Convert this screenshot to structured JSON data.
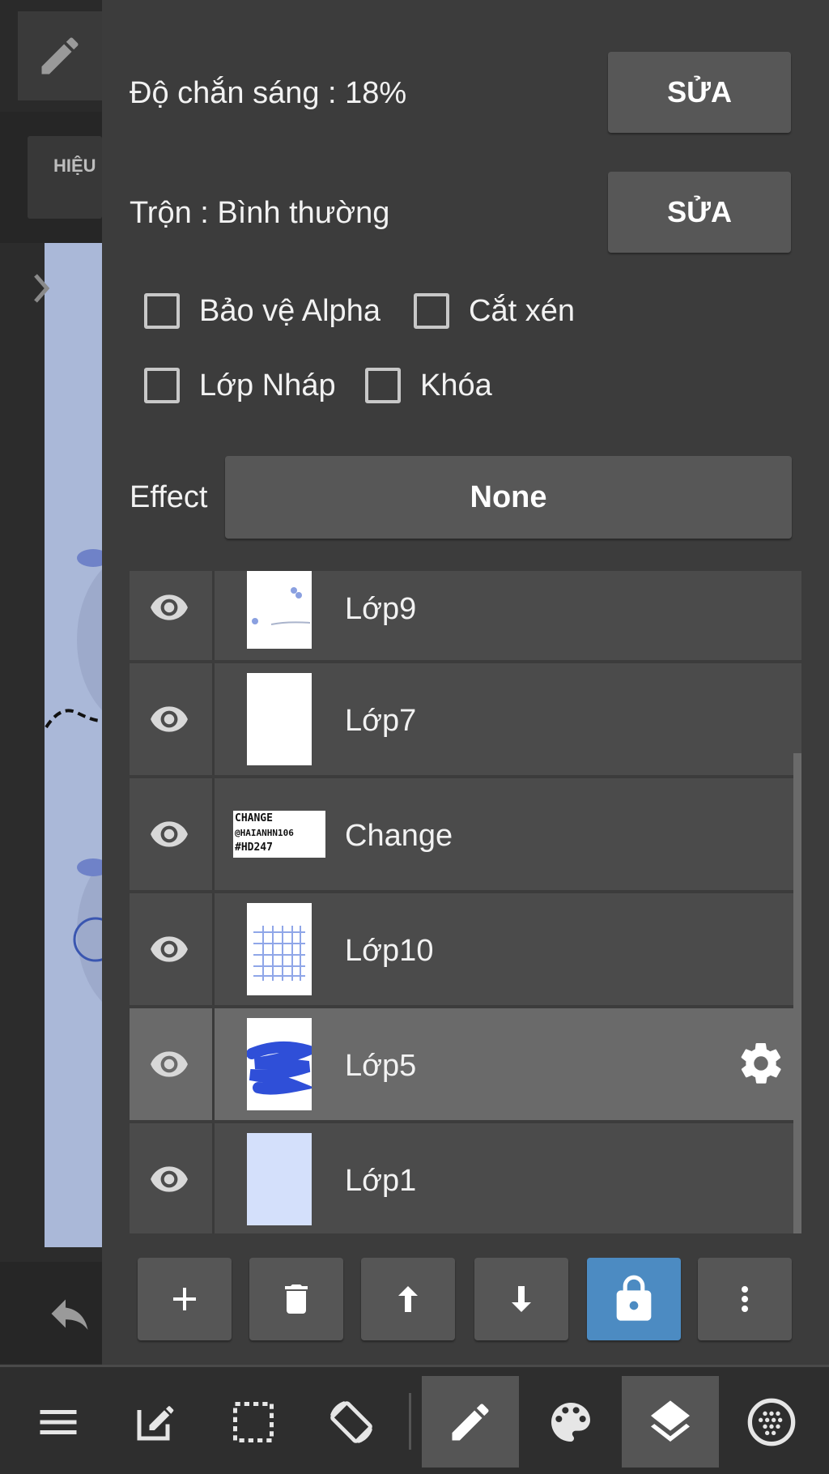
{
  "opacity": {
    "label": "Độ chắn sáng : 18%",
    "edit_label": "SỬA"
  },
  "blend": {
    "label": "Trộn : Bình thường",
    "edit_label": "SỬA"
  },
  "checkboxes": {
    "alpha_protect": {
      "label": "Bảo vệ Alpha",
      "checked": false
    },
    "clipping": {
      "label": "Cắt xén",
      "checked": false
    },
    "draft_layer": {
      "label": "Lớp Nháp",
      "checked": false
    },
    "lock": {
      "label": "Khóa",
      "checked": false
    }
  },
  "effect": {
    "label": "Effect",
    "value": "None"
  },
  "layers": [
    {
      "name": "Lớp9",
      "thumb": "sketch-flowers",
      "selected": false
    },
    {
      "name": "Lớp7",
      "thumb": "blank-white",
      "selected": false
    },
    {
      "name": "Change",
      "thumb": "text",
      "thumb_text": [
        "CHANGE",
        "@HAIANHN106",
        "#HD247"
      ],
      "selected": false
    },
    {
      "name": "Lớp10",
      "thumb": "grid",
      "selected": false
    },
    {
      "name": "Lớp5",
      "thumb": "blue-scribble",
      "selected": true
    },
    {
      "name": "Lớp1",
      "thumb": "light-blue",
      "selected": false
    }
  ],
  "left_panel": {
    "effect_tab_label": "HIỆU"
  },
  "colors": {
    "background": "#3c3c3c",
    "button": "#575757",
    "active_button": "#4c8bc2",
    "selected_layer": "#6a6a6a",
    "layer_row": "#4b4b4b"
  },
  "toolbar": [
    "add-icon",
    "trash-icon",
    "arrow-up-icon",
    "arrow-down-icon",
    "lock-icon",
    "more-vert-icon"
  ],
  "bottom_nav": [
    "menu-icon",
    "edit-square-icon",
    "selection-icon",
    "rotate-icon",
    "pen-icon",
    "palette-icon",
    "layers-icon",
    "materials-icon"
  ]
}
